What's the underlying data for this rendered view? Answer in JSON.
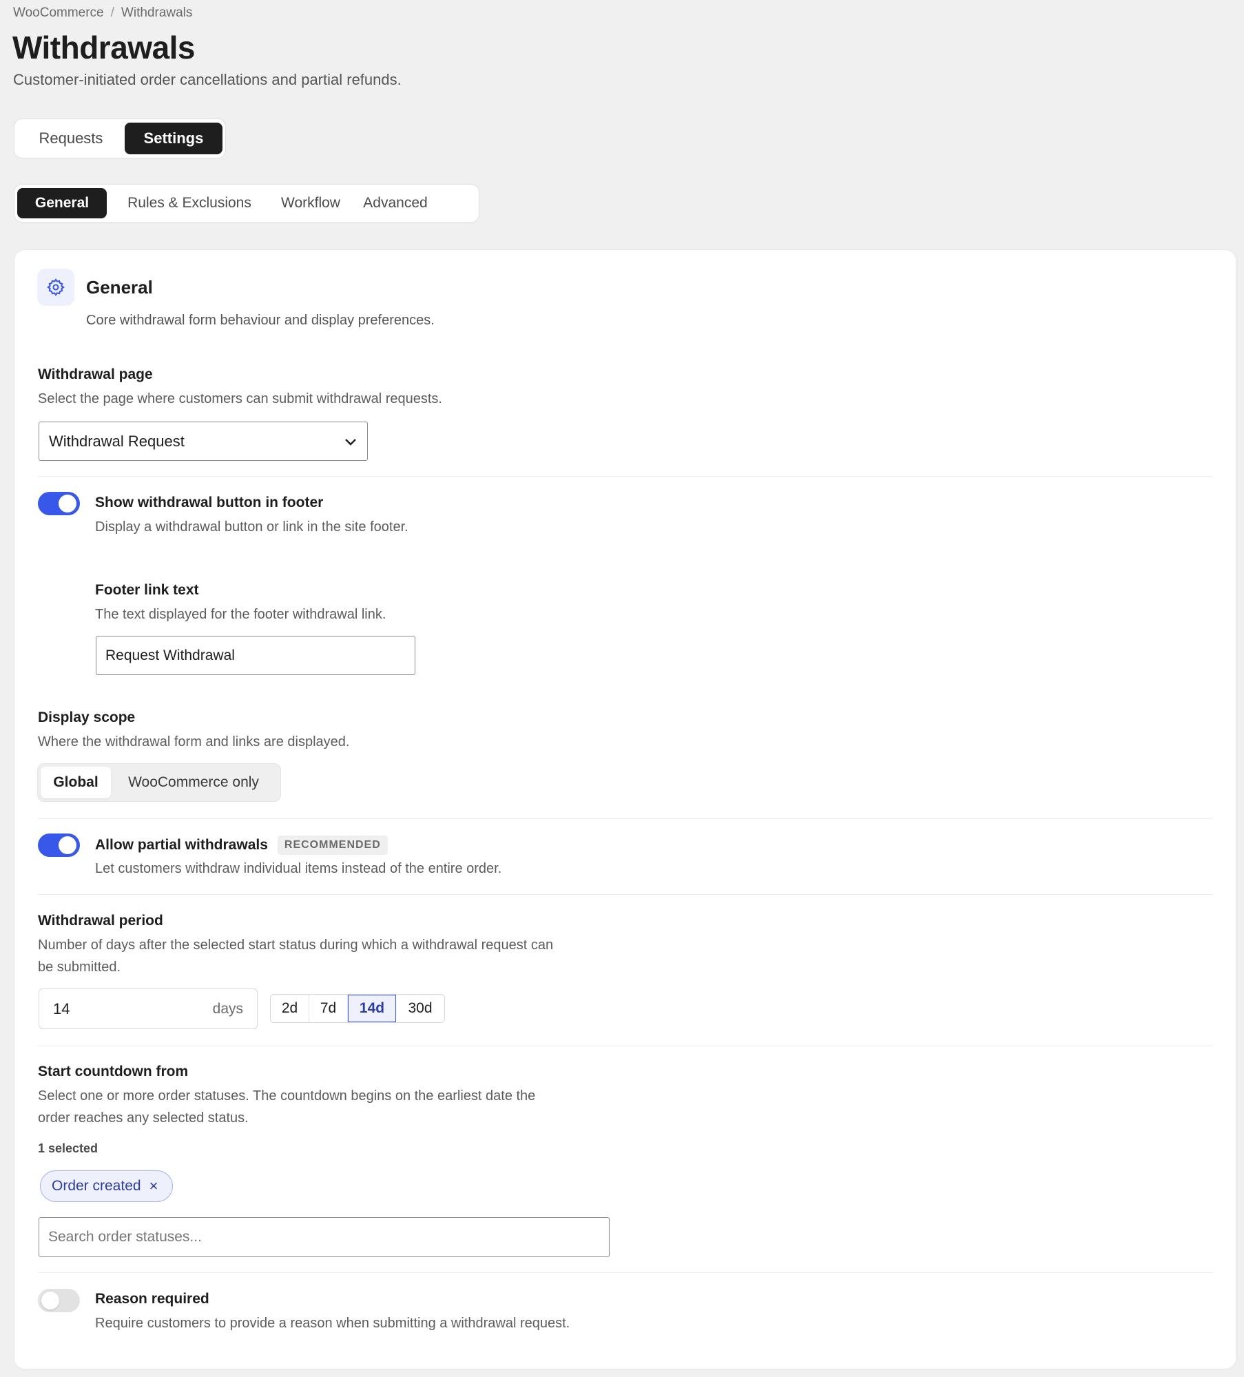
{
  "breadcrumb": {
    "root": "WooCommerce",
    "separator": "/",
    "current": "Withdrawals"
  },
  "header": {
    "title": "Withdrawals",
    "subtitle": "Customer-initiated order cancellations and partial refunds."
  },
  "main_tabs": [
    {
      "label": "Requests",
      "active": false
    },
    {
      "label": "Settings",
      "active": true
    }
  ],
  "sub_tabs": [
    {
      "label": "General",
      "active": true
    },
    {
      "label": "Rules & Exclusions",
      "active": false
    },
    {
      "label": "Workflow",
      "active": false
    },
    {
      "label": "Advanced",
      "active": false
    }
  ],
  "section": {
    "icon": "gear-icon",
    "title": "General",
    "description": "Core withdrawal form behaviour and display preferences."
  },
  "withdrawal_page": {
    "label": "Withdrawal page",
    "help": "Select the page where customers can submit withdrawal requests.",
    "selected": "Withdrawal Request"
  },
  "footer_button": {
    "label": "Show withdrawal button in footer",
    "help": "Display a withdrawal button or link in the site footer.",
    "enabled": true
  },
  "footer_link": {
    "label": "Footer link text",
    "help": "The text displayed for the footer withdrawal link.",
    "value": "Request Withdrawal"
  },
  "display_scope": {
    "label": "Display scope",
    "help": "Where the withdrawal form and links are displayed.",
    "options": [
      "Global",
      "WooCommerce only"
    ],
    "selected": "Global"
  },
  "partial": {
    "label": "Allow partial withdrawals",
    "badge": "RECOMMENDED",
    "help": "Let customers withdraw individual items instead of the entire order.",
    "enabled": true
  },
  "period": {
    "label": "Withdrawal period",
    "help_line1": "Number of days after the selected start status during which a withdrawal request can",
    "help_line2": "be submitted.",
    "value": "14",
    "unit": "days",
    "presets": [
      "2d",
      "7d",
      "14d",
      "30d"
    ],
    "active_preset": "14d"
  },
  "countdown": {
    "label": "Start countdown from",
    "help_line1": "Select one or more order statuses. The countdown begins on the earliest date the",
    "help_line2": "order reaches any selected status.",
    "selected_count": "1 selected",
    "chips": [
      "Order created"
    ],
    "chip_remove": "×",
    "search_placeholder": "Search order statuses..."
  },
  "reason": {
    "label": "Reason required",
    "help": "Require customers to provide a reason when submitting a withdrawal request.",
    "enabled": false
  },
  "colors": {
    "accent": "#3858e9",
    "dark": "#1e1e1e",
    "page_bg": "#f0f0f0"
  }
}
